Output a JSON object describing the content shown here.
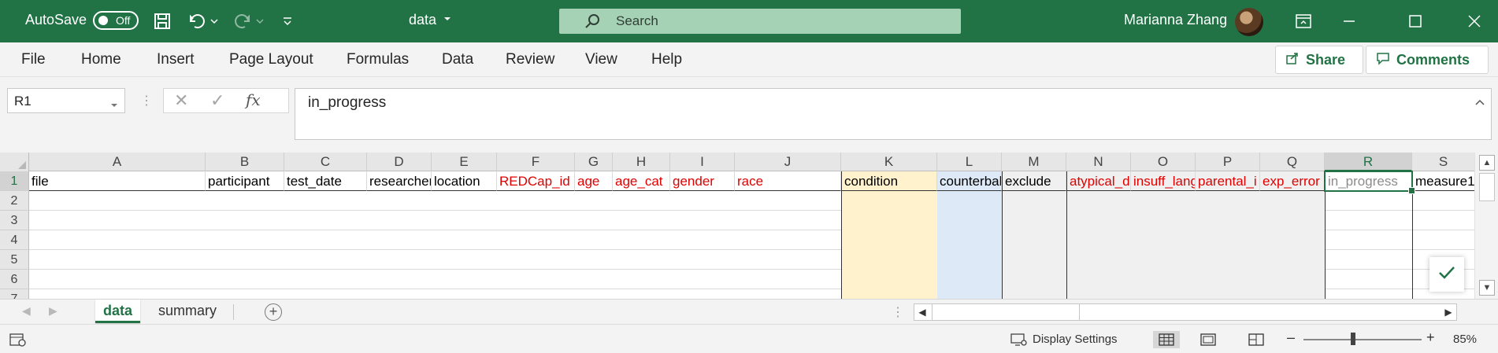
{
  "titlebar": {
    "autosave_label": "AutoSave",
    "autosave_state": "Off",
    "document_name": "data",
    "search_placeholder": "Search",
    "user_name": "Marianna Zhang"
  },
  "menu": {
    "items": [
      "File",
      "Home",
      "Insert",
      "Page Layout",
      "Formulas",
      "Data",
      "Review",
      "View",
      "Help"
    ],
    "share_label": "Share",
    "comments_label": "Comments"
  },
  "formula_bar": {
    "name_box": "R1",
    "formula": "in_progress",
    "fx_label": "fx"
  },
  "sheet": {
    "columns": [
      "A",
      "B",
      "C",
      "D",
      "E",
      "F",
      "G",
      "H",
      "I",
      "J",
      "K",
      "L",
      "M",
      "N",
      "O",
      "P",
      "Q",
      "R",
      "S"
    ],
    "rows": [
      "1",
      "2",
      "3",
      "4",
      "5",
      "6",
      "7"
    ],
    "header_row": [
      "file",
      "participant",
      "test_date",
      "researcher",
      "location",
      "REDCap_id",
      "age",
      "age_cat",
      "gender",
      "race",
      "condition",
      "counterbalance",
      "exclude",
      "atypical_d",
      "insuff_lang",
      "parental_i",
      "exp_error",
      "in_progress",
      "measure1"
    ],
    "selected_cell": "R1"
  },
  "tabs": {
    "items": [
      "data",
      "summary"
    ],
    "active": "data"
  },
  "status": {
    "display_settings": "Display Settings",
    "zoom": "85%"
  },
  "colors": {
    "brand": "#217346",
    "header_red": "#e00000",
    "condition_fill": "#fff2cc",
    "counterbalance_fill": "#dde9f7",
    "exclude_fill": "#f0f0f0"
  }
}
